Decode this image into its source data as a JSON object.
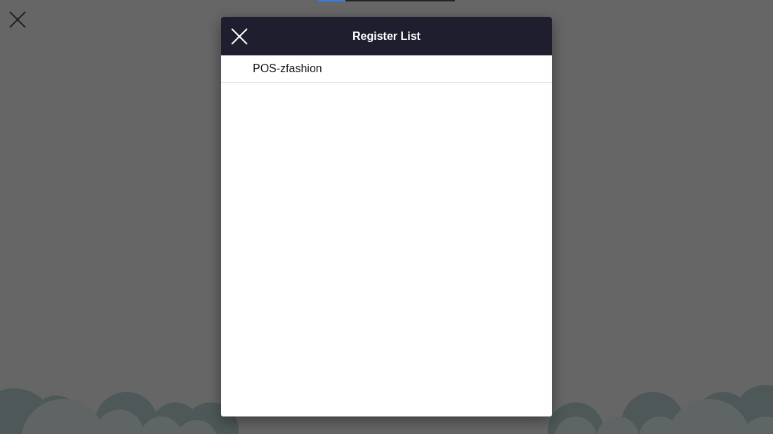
{
  "progress": {
    "level": 0.2
  },
  "dialog": {
    "title": "Register List",
    "items": [
      {
        "label": "POS-zfashion"
      }
    ]
  }
}
